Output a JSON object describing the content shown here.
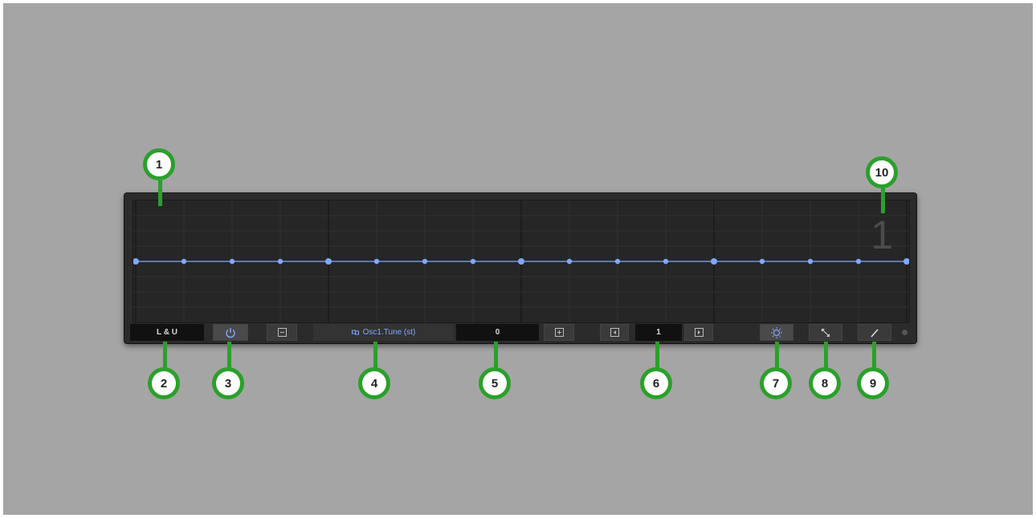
{
  "device": {
    "step_display": "1",
    "mode_label": "L & U",
    "parameter_label": "Osc1.Tune (st)",
    "value_display": "0",
    "step_count_display": "1",
    "accent_color": "#7fa8ff",
    "points_count": 17,
    "points_level": 0.5
  },
  "icons": {
    "power": "power-icon",
    "minus": "minus-icon",
    "plus": "plus-icon",
    "prev": "previous-icon",
    "next": "next-icon",
    "link": "link-icon",
    "snap": "snap-icon",
    "expand": "expand-icon",
    "draw": "pencil-icon"
  },
  "callouts": [
    "1",
    "2",
    "3",
    "4",
    "5",
    "6",
    "7",
    "8",
    "9",
    "10"
  ],
  "colors": {
    "callout_green": "#2aa02a",
    "background": "#a5a5a5"
  }
}
